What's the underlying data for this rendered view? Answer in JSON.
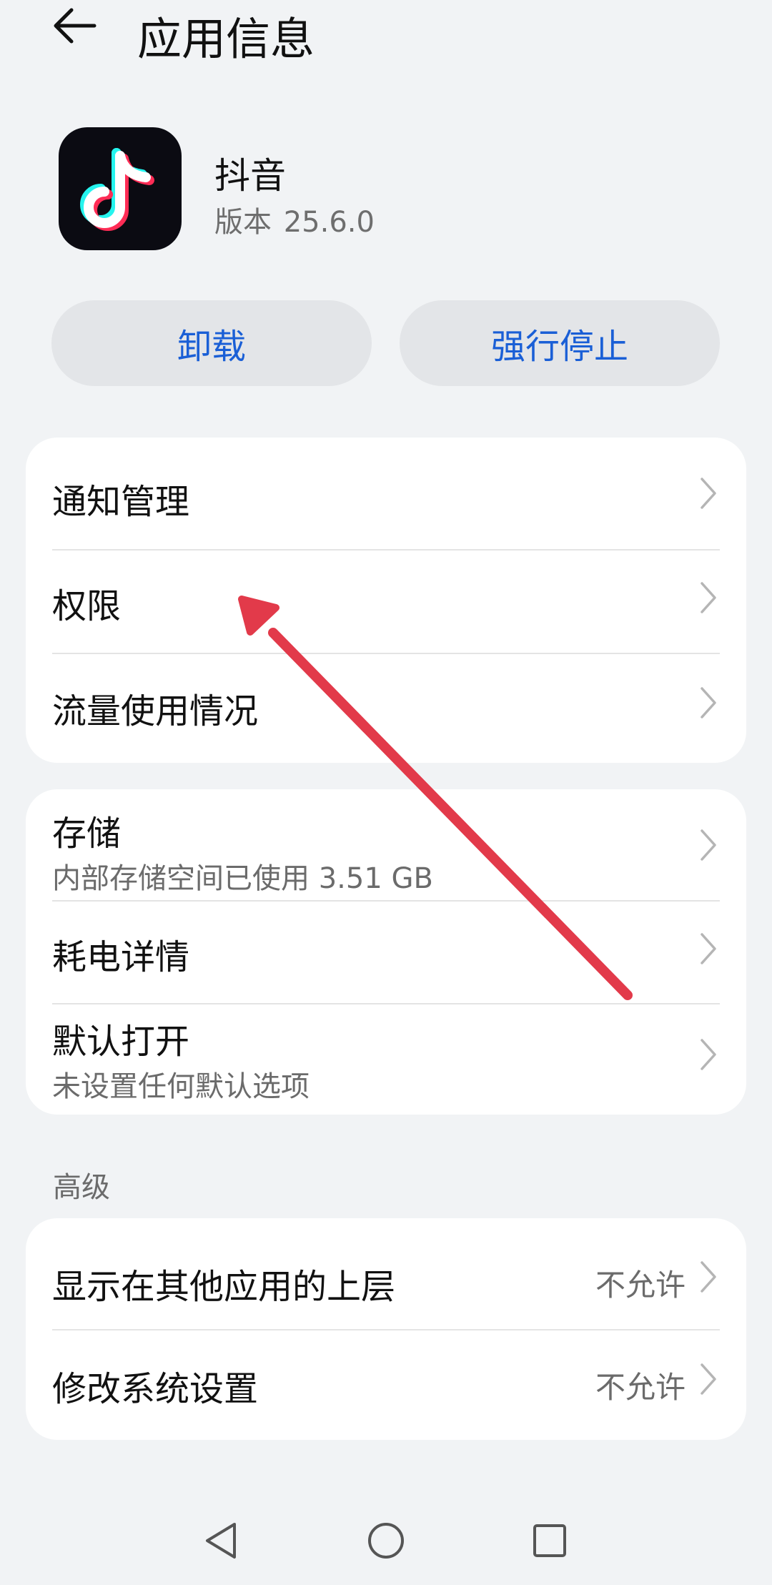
{
  "header": {
    "title": "应用信息"
  },
  "app": {
    "name": "抖音",
    "version_label": "版本",
    "version": "25.6.0"
  },
  "actions": {
    "uninstall": "卸载",
    "force_stop": "强行停止"
  },
  "group1": {
    "notifications": "通知管理",
    "permissions": "权限",
    "data_usage": "流量使用情况"
  },
  "group2": {
    "storage": "存储",
    "storage_sub": "内部存储空间已使用 3.51 GB",
    "battery": "耗电详情",
    "default_open": "默认打开",
    "default_open_sub": "未设置任何默认选项"
  },
  "advanced": {
    "label": "高级",
    "overlay": "显示在其他应用的上层",
    "overlay_value": "不允许",
    "modify_settings": "修改系统设置",
    "modify_settings_value": "不允许"
  },
  "colors": {
    "accent": "#1a5fd6",
    "background": "#f1f3f5",
    "annotation_arrow": "#e23a4a"
  },
  "icons": {
    "back": "arrow-left-icon",
    "chevron": "chevron-right-icon",
    "nav_back": "triangle-back-icon",
    "nav_home": "circle-home-icon",
    "nav_recents": "square-recents-icon"
  }
}
